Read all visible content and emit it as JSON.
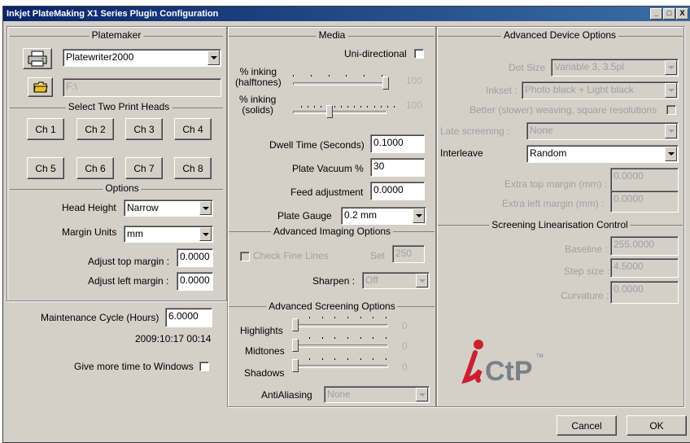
{
  "window": {
    "title": "Inkjet PlateMaking X1 Series Plugin Configuration",
    "min": "_",
    "max": "□",
    "close": "X"
  },
  "platemaker": {
    "title": "Platemaker",
    "printer": "Platewriter2000",
    "path": "F:\\"
  },
  "heads": {
    "title": "Select Two Print Heads",
    "buttons": [
      "Ch 1",
      "Ch 2",
      "Ch 3",
      "Ch 4",
      "Ch 5",
      "Ch 6",
      "Ch 7",
      "Ch 8"
    ]
  },
  "options": {
    "title": "Options",
    "head_height_label": "Head Height",
    "head_height": "Narrow",
    "margin_units_label": "Margin Units",
    "margin_units": "mm",
    "adj_top_label": "Adjust top margin :",
    "adj_top": "0.0000",
    "adj_left_label": "Adjust left margin :",
    "adj_left": "0.0000"
  },
  "maintenance": {
    "label": "Maintenance Cycle (Hours)",
    "value": "6.0000",
    "date": "2009:10:17 00:14",
    "windows_label": "Give more time to Windows"
  },
  "media": {
    "title": "Media",
    "unidir": "Uni-directional",
    "inking_half_label": "% inking\n(halftones)",
    "inking_half_line1": "% inking",
    "inking_half_line2": "(halftones)",
    "inking_half_value": "100",
    "inking_half_level": 1.0,
    "inking_solid_line1": "% inking",
    "inking_solid_line2": "(solids)",
    "inking_solid_value": "100",
    "inking_solid_level": 0.35,
    "dwell_label": "Dwell Time (Seconds)",
    "dwell": "0.1000",
    "vacuum_label": "Plate Vacuum %",
    "vacuum": "30",
    "feed_label": "Feed adjustment",
    "feed": "0.0000",
    "gauge_label": "Plate Gauge",
    "gauge": "0.2  mm"
  },
  "imaging": {
    "title": "Advanced Imaging Options",
    "fine_lines": "Check Fine Lines",
    "set_label": "Set",
    "set_value": "250",
    "sharpen_label": "Sharpen :",
    "sharpen": "Off"
  },
  "screening": {
    "title": "Advanced Screening Options",
    "highlights": "Highlights",
    "midtones": "Midtones",
    "shadows": "Shadows",
    "hl_value": "0",
    "mt_value": "0",
    "sh_value": "0",
    "antialias_label": "AntiAliasing",
    "antialias": "None"
  },
  "device": {
    "title": "Advanced Device Options",
    "dot_size_label": "Dot Size",
    "dot_size": "Variable 3, 3.5pl",
    "inkset_label": "Inkset :",
    "inkset": "Photo black + Light black",
    "weaving": "Better (slower) weaving, square resolutions",
    "late_label": "Late screening :",
    "late": "None",
    "interleave_label": "Interleave",
    "interleave": "Random",
    "extra_top_label": "Extra top margin (mm) :",
    "extra_top": "0.0000",
    "extra_left_label": "Extra left margin (mm) :",
    "extra_left": "0.0000"
  },
  "linear": {
    "title": "Screening Linearisation Control",
    "baseline_label": "Baseline :",
    "baseline": "255.0000",
    "step_label": "Step size :",
    "step": "4.5000",
    "curv_label": "Curvature :",
    "curv": "0.0000"
  },
  "logo": {
    "letters": "iCtP",
    "tm": "TM",
    "accent": "#cc1f2f"
  },
  "footer": {
    "cancel": "Cancel",
    "ok": "OK"
  }
}
